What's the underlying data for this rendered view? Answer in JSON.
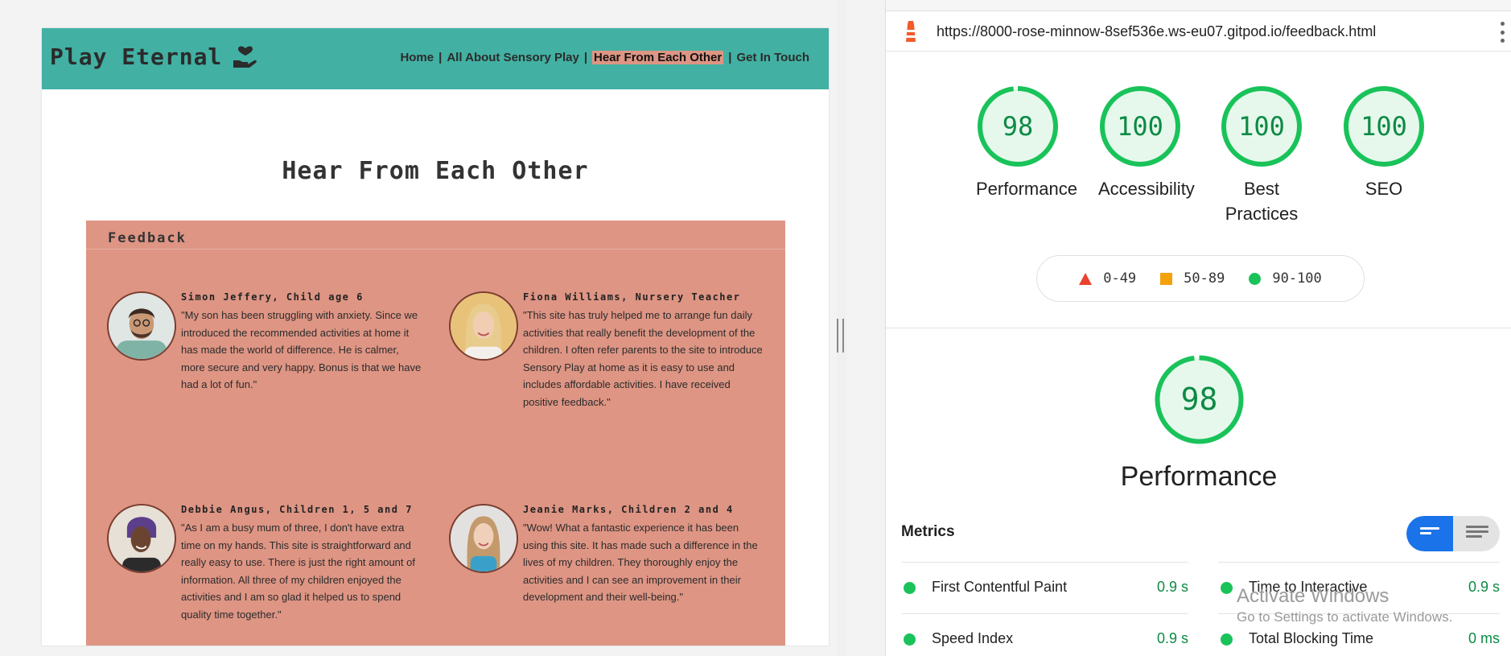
{
  "site": {
    "brand": "Play Eternal",
    "nav": {
      "home": "Home",
      "about": "All About Sensory Play",
      "feedback": "Hear From Each Other",
      "contact": "Get In Touch",
      "separator": "|"
    },
    "page_title": "Hear From Each Other",
    "section_title": "Feedback",
    "colors": {
      "nav_bg": "#42b0a3",
      "feedback_bg": "#de9584"
    },
    "testimonials": [
      {
        "name": "Simon Jeffery, Child age 6",
        "text": "\"My son has been struggling with anxiety. Since we introduced the recommended activities at home it has made the world of difference. He is calmer, more secure and very happy. Bonus is that we have had a lot of fun.\""
      },
      {
        "name": "Fiona Williams, Nursery Teacher",
        "text": "\"This site has truly helped me to arrange fun daily activities that really benefit the development of the children. I often refer parents to the site to introduce Sensory Play at home as it is easy to use and includes affordable activities. I have received positive feedback.\""
      },
      {
        "name": "Debbie Angus, Children 1, 5 and 7",
        "text": "\"As I am a busy mum of three, I don't have extra time on my hands. This site is straightforward and really easy to use. There is just the right amount of information. All three of my children enjoyed the activities and I am so glad it helped us to spend quality time together.\""
      },
      {
        "name": "Jeanie Marks, Children 2 and 4",
        "text": "\"Wow! What a fantastic experience it has been using this site. It has made such a difference in the lives of my children. They thoroughly enjoy the activities and I can see an improvement in their development and their well-being.\""
      }
    ]
  },
  "lighthouse": {
    "url": "https://8000-rose-minnow-8sef536e.ws-eu07.gitpod.io/feedback.html",
    "scores": [
      {
        "value": "98",
        "label": "Performance",
        "fraction": 0.98
      },
      {
        "value": "100",
        "label": "Accessibility",
        "fraction": 1.0
      },
      {
        "value": "100",
        "label": "Best Practices",
        "fraction": 1.0
      },
      {
        "value": "100",
        "label": "SEO",
        "fraction": 1.0
      }
    ],
    "legend": {
      "fail": "0-49",
      "average": "50-89",
      "pass": "90-100"
    },
    "performance": {
      "value": "98",
      "title": "Performance",
      "fraction": 0.98
    },
    "metrics_title": "Metrics",
    "metrics": [
      {
        "name": "First Contentful Paint",
        "value": "0.9 s"
      },
      {
        "name": "Time to Interactive",
        "value": "0.9 s"
      },
      {
        "name": "Speed Index",
        "value": "0.9 s"
      },
      {
        "name": "Total Blocking Time",
        "value": "0 ms"
      }
    ],
    "colors": {
      "pass": "#19c35a",
      "pass_text": "#0c8a44",
      "average": "#f5a10a",
      "fail": "#e9432f",
      "toggle": "#1a73e8"
    }
  },
  "watermark": {
    "line1": "Activate Windows",
    "line2": "Go to Settings to activate Windows."
  }
}
